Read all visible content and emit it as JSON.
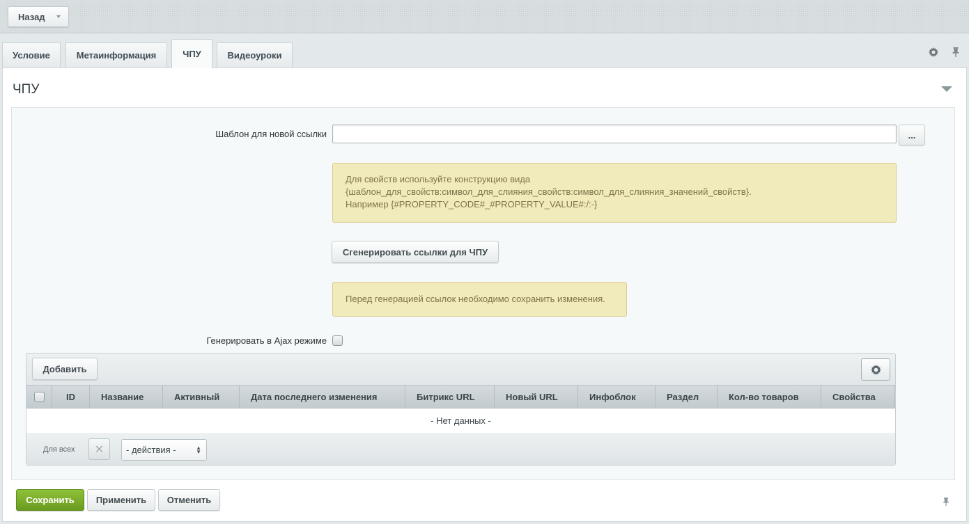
{
  "header": {
    "back_label": "Назад"
  },
  "tabs": [
    {
      "label": "Условие"
    },
    {
      "label": "Метаинформация"
    },
    {
      "label": "ЧПУ"
    },
    {
      "label": "Видеоуроки"
    }
  ],
  "active_tab": "ЧПУ",
  "tab_tools": [
    "gear-icon",
    "pin-icon"
  ],
  "section": {
    "title": "ЧПУ"
  },
  "form": {
    "template_label": "Шаблон для новой ссылки",
    "template_value": "",
    "dots_label": "...",
    "hint_line1": "Для свойств используйте конструкцию вида",
    "hint_line2": "{шаблон_для_свойств:символ_для_слияния_свойств:символ_для_слияния_значений_свойств}.",
    "hint_line3": "Например {#PROPERTY_CODE#_#PROPERTY_VALUE#:/:-}",
    "generate_label": "Сгенерировать ссылки для ЧПУ",
    "warning": "Перед генерацией ссылок необходимо сохранить изменения.",
    "ajax_label": "Генерировать в Ajax режиме",
    "ajax_checked": false
  },
  "grid": {
    "add_label": "Добавить",
    "columns": [
      "ID",
      "Название",
      "Активный",
      "Дата последнего изменения",
      "Битрикс URL",
      "Новый URL",
      "Инфоблок",
      "Раздел",
      "Кол-во товаров",
      "Свойства"
    ],
    "empty_text": "- Нет данных -",
    "for_all_label": "Для всех",
    "action_select": "- действия -"
  },
  "footer": {
    "save_label": "Сохранить",
    "apply_label": "Применить",
    "cancel_label": "Отменить"
  },
  "colors": {
    "save_button": "#7aac2a",
    "note_background": "#f1eaba",
    "note_text": "#7e744c"
  }
}
